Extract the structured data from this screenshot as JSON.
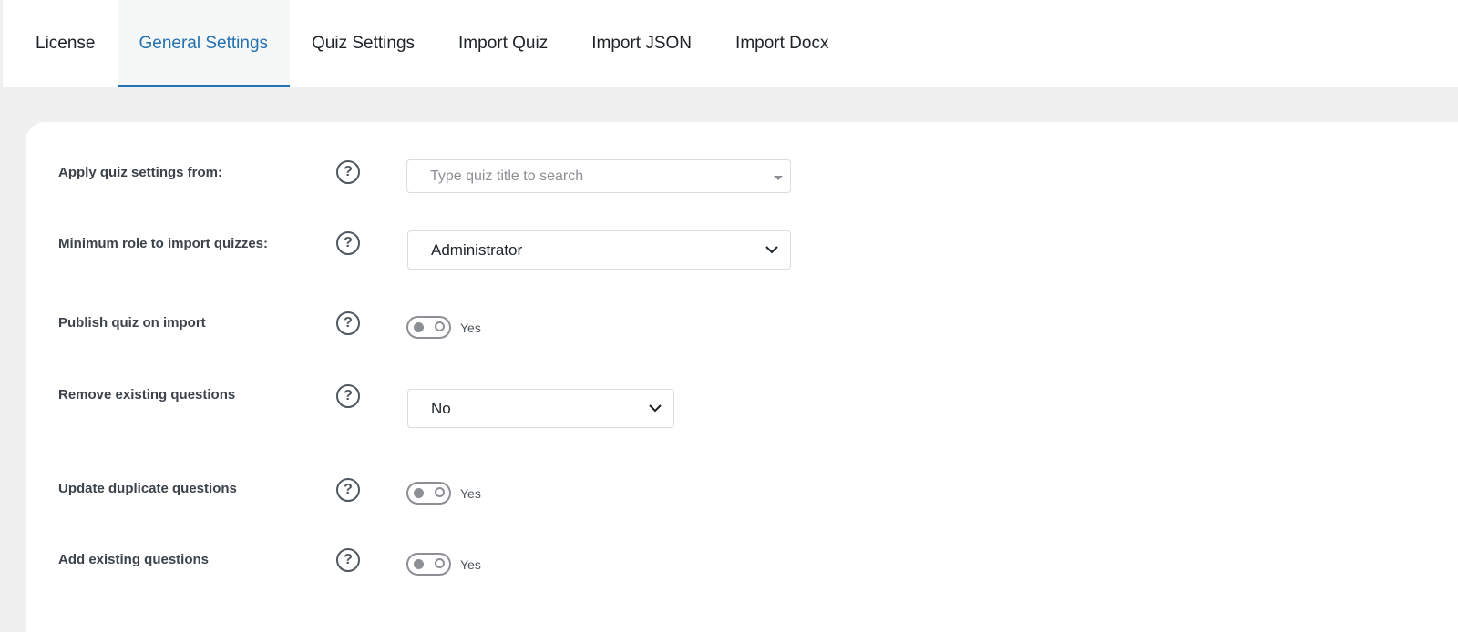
{
  "tabs": [
    {
      "label": "License",
      "active": false
    },
    {
      "label": "General Settings",
      "active": true
    },
    {
      "label": "Quiz Settings",
      "active": false
    },
    {
      "label": "Import Quiz",
      "active": false
    },
    {
      "label": "Import JSON",
      "active": false
    },
    {
      "label": "Import Docx",
      "active": false
    }
  ],
  "settings": {
    "apply_quiz_settings": {
      "label": "Apply quiz settings from:",
      "placeholder": "Type quiz title to search",
      "value": ""
    },
    "minimum_role": {
      "label": "Minimum role to import quizzes:",
      "value": "Administrator"
    },
    "publish_on_import": {
      "label": "Publish quiz on import",
      "toggle_text": "Yes",
      "checked": false
    },
    "remove_existing": {
      "label": "Remove existing questions",
      "value": "No"
    },
    "update_duplicates": {
      "label": "Update duplicate questions",
      "toggle_text": "Yes",
      "checked": false
    },
    "add_existing": {
      "label": "Add existing questions",
      "toggle_text": "Yes",
      "checked": false
    }
  },
  "icons": {
    "help": "question-circle-icon",
    "dropdown": "chevron-down-icon"
  },
  "help_glyph": "?",
  "colors": {
    "accent": "#2271b1",
    "page_bg": "#f0f0f1",
    "panel_bg": "#ffffff"
  }
}
